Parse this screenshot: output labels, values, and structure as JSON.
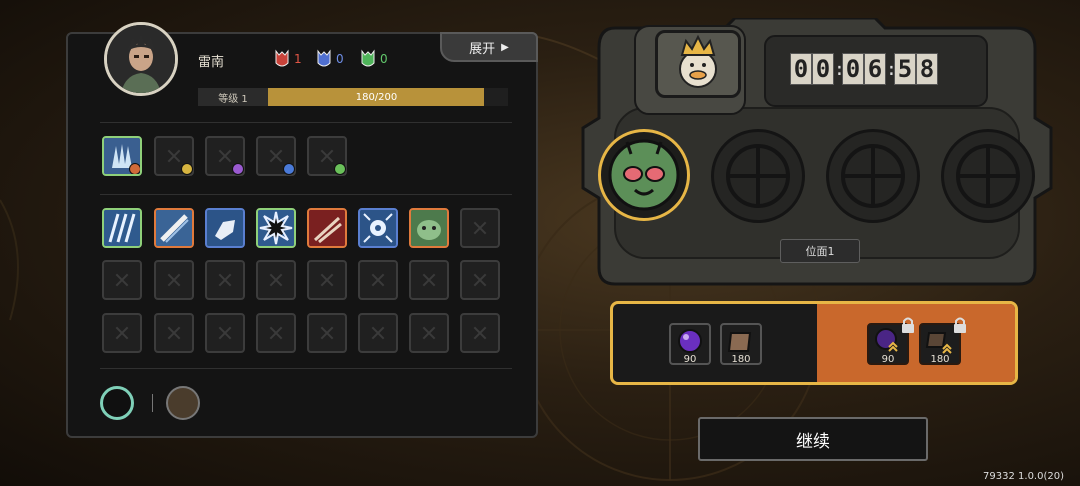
{
  "hero": {
    "name": "雷南",
    "level_label": "等级 1",
    "xp_text": "180/200",
    "xp_progress": 0.9
  },
  "resources": [
    {
      "icon": "red-mask-icon",
      "value": "1",
      "color": "#c9433a"
    },
    {
      "icon": "blue-mask-icon",
      "value": "0",
      "color": "#4f6fd0"
    },
    {
      "icon": "green-mask-icon",
      "value": "0",
      "color": "#4fb45a"
    }
  ],
  "expand_button": {
    "label": "展开"
  },
  "timer": {
    "digits": [
      "0",
      "0",
      "0",
      "6",
      "5",
      "8"
    ]
  },
  "stage": {
    "label": "位面1"
  },
  "rewards": {
    "free": [
      {
        "icon": "purple-orb-icon",
        "count": "90"
      },
      {
        "icon": "leather-scroll-icon",
        "count": "180"
      }
    ],
    "locked": [
      {
        "icon": "purple-orb-upgrade-icon",
        "count": "90"
      },
      {
        "icon": "leather-scroll-upgrade-icon",
        "count": "180"
      }
    ]
  },
  "continue_button": {
    "label": "继续"
  },
  "version": "79332 1.0.0(20)",
  "colors": {
    "xp_fill": "#b8923a",
    "reward_border": "#e7b646",
    "reward_locked_bg": "#c9682c",
    "skill_border_green": "#8fd07a",
    "skill_border_orange": "#e07a3c",
    "skill_border_blue": "#5a7fd0"
  }
}
